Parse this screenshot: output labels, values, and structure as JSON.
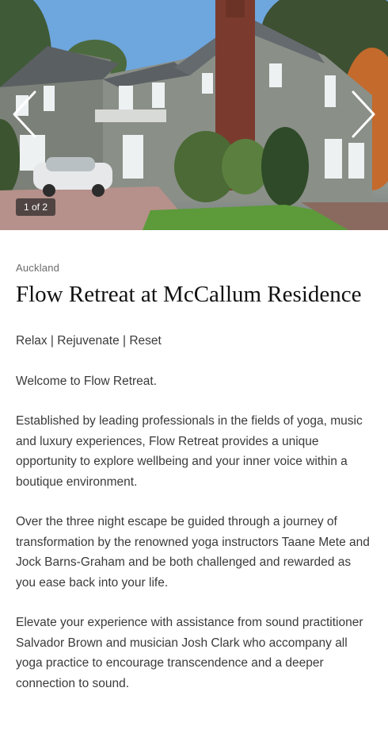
{
  "gallery": {
    "counter": "1 of 2",
    "prev_icon": "chevron-left-icon",
    "next_icon": "chevron-right-icon"
  },
  "listing": {
    "location": "Auckland",
    "title": "Flow Retreat at McCallum Residence",
    "tagline": "Relax | Rejuvenate | Reset",
    "paragraphs": [
      "Welcome to Flow Retreat.",
      "Established by leading professionals in the fields of yoga, music and luxury experiences, Flow Retreat provides a unique opportunity to explore wellbeing and your inner voice within a boutique environment.",
      "Over the three night escape be guided through a journey of transformation by the renowned yoga instructors Taane Mete and Jock Barns-Graham and be both challenged and rewarded as you ease back into your life.",
      "Elevate your experience with assistance from sound practitioner Salvador Brown and musician Josh Clark who accompany all yoga practice to encourage transcendence and a deeper connection to sound."
    ]
  }
}
